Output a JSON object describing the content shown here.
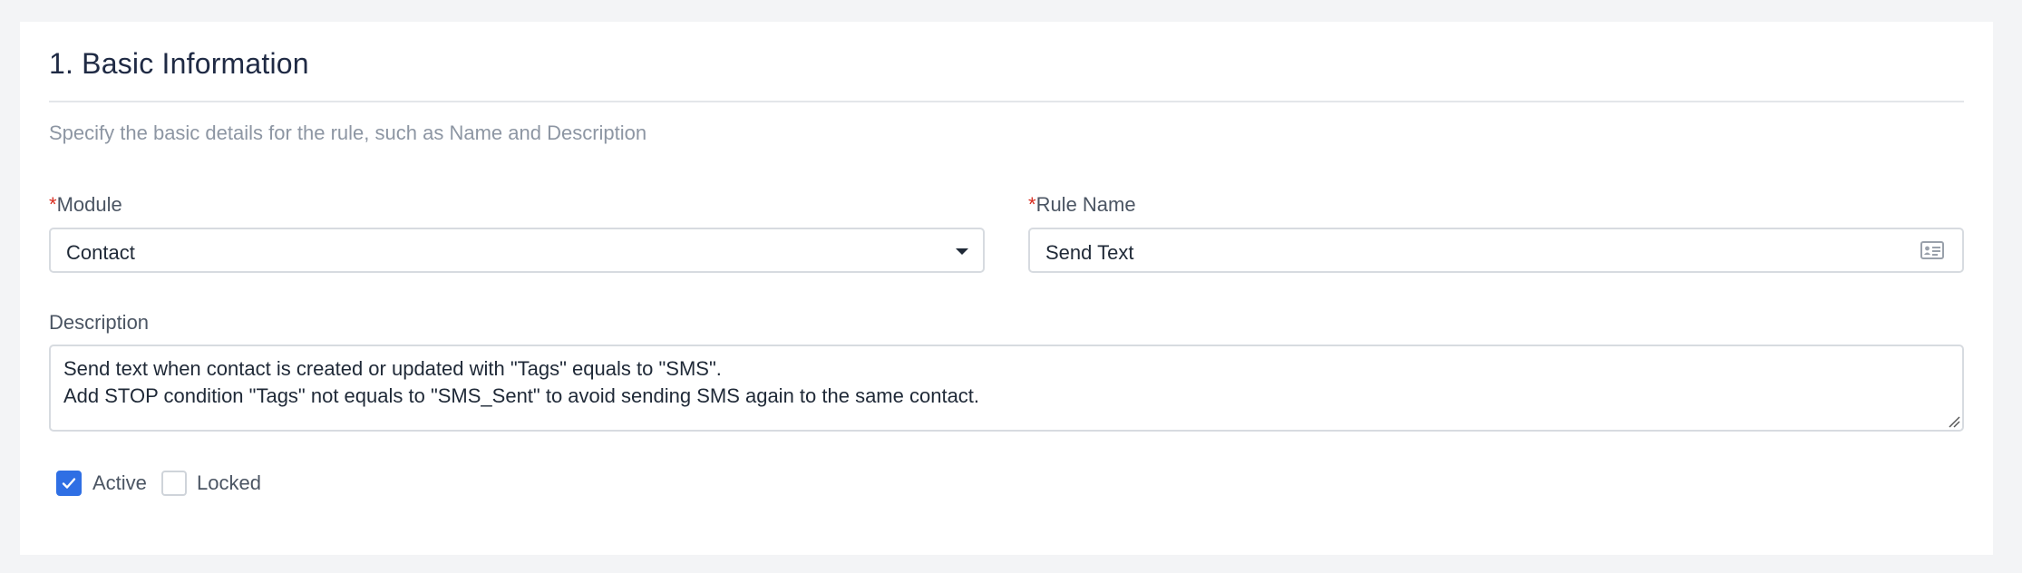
{
  "section": {
    "title": "1. Basic Information",
    "subtitle": "Specify the basic details for the rule, such as Name and Description"
  },
  "module": {
    "required_mark": "*",
    "label": "Module",
    "value": "Contact",
    "icon": "chevron-down-icon"
  },
  "rule_name": {
    "required_mark": "*",
    "label": "Rule Name",
    "value": "Send Text",
    "icon": "id-card-icon"
  },
  "description": {
    "label": "Description",
    "lines": [
      "Send text when contact is created or updated with \"Tags\" equals to \"SMS\".",
      "Add STOP condition \"Tags\" not equals to \"SMS_Sent\" to avoid sending SMS again to the same contact."
    ]
  },
  "flags": {
    "active_label": "Active",
    "active_checked": true,
    "locked_label": "Locked",
    "locked_checked": false
  },
  "colors": {
    "accent": "#2f6fe4",
    "required": "#d92d20",
    "background": "#f3f4f6"
  }
}
